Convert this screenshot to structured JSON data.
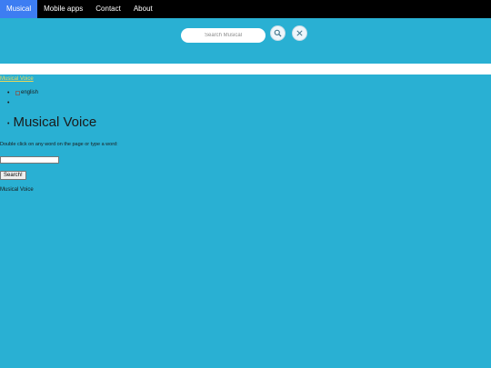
{
  "nav": {
    "items": [
      {
        "label": "Musical",
        "active": true
      },
      {
        "label": "Mobile apps",
        "active": false
      },
      {
        "label": "Contact",
        "active": false
      },
      {
        "label": "About",
        "active": false
      }
    ]
  },
  "search": {
    "placeholder": "Search Musical",
    "search_icon": "search-icon",
    "close_icon": "close-icon"
  },
  "content": {
    "top_link": "Musical Voice",
    "language_alt": "english",
    "title": "Musical Voice",
    "instruction": "Double click on any word on the page or type a word:",
    "word_input_value": "",
    "submit_label": "Search!",
    "footer": "Musical Voice"
  },
  "colors": {
    "background": "#29b0d3",
    "nav_bg": "#000000",
    "nav_active": "#3d7df2",
    "link": "#e8d75a"
  }
}
